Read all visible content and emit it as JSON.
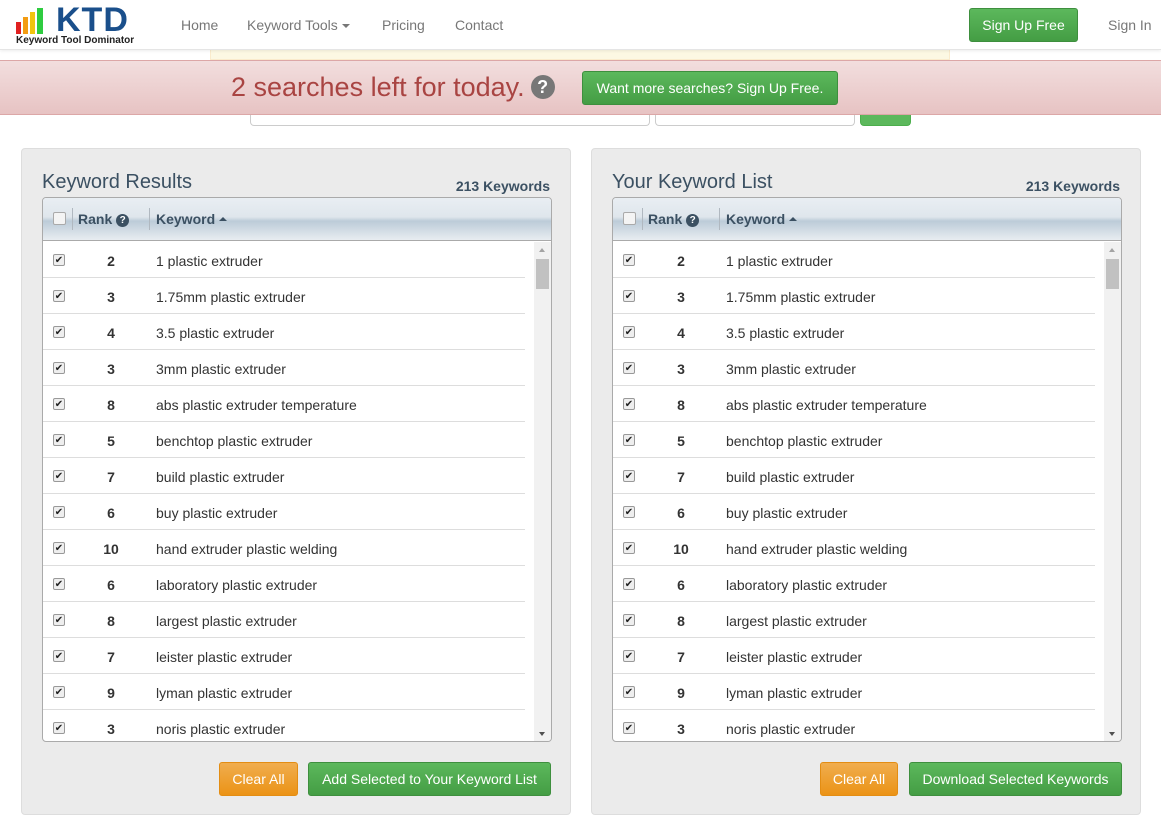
{
  "nav": {
    "logo_text": "KTD",
    "logo_sub": "Keyword Tool Dominator",
    "links": [
      "Home",
      "Keyword Tools",
      "Pricing",
      "Contact"
    ],
    "signup": "Sign Up Free",
    "signin": "Sign In"
  },
  "alert": {
    "message": "2 searches left for today.",
    "help_icon": "?",
    "cta": "Want more searches? Sign Up Free."
  },
  "left": {
    "title": "Keyword Results",
    "count": "213 Keywords",
    "col_rank": "Rank",
    "col_keyword": "Keyword",
    "clear": "Clear All",
    "action": "Add Selected to Your Keyword List"
  },
  "right": {
    "title": "Your Keyword List",
    "count": "213 Keywords",
    "col_rank": "Rank",
    "col_keyword": "Keyword",
    "clear": "Clear All",
    "action": "Download Selected Keywords"
  },
  "rows": [
    {
      "rank": "2",
      "keyword": "1 plastic extruder",
      "checked": true
    },
    {
      "rank": "3",
      "keyword": "1.75mm plastic extruder",
      "checked": true
    },
    {
      "rank": "4",
      "keyword": "3.5 plastic extruder",
      "checked": true
    },
    {
      "rank": "3",
      "keyword": "3mm plastic extruder",
      "checked": true
    },
    {
      "rank": "8",
      "keyword": "abs plastic extruder temperature",
      "checked": true
    },
    {
      "rank": "5",
      "keyword": "benchtop plastic extruder",
      "checked": true
    },
    {
      "rank": "7",
      "keyword": "build plastic extruder",
      "checked": true
    },
    {
      "rank": "6",
      "keyword": "buy plastic extruder",
      "checked": true
    },
    {
      "rank": "10",
      "keyword": "hand extruder plastic welding",
      "checked": true
    },
    {
      "rank": "6",
      "keyword": "laboratory plastic extruder",
      "checked": true
    },
    {
      "rank": "8",
      "keyword": "largest plastic extruder",
      "checked": true
    },
    {
      "rank": "7",
      "keyword": "leister plastic extruder",
      "checked": true
    },
    {
      "rank": "9",
      "keyword": "lyman plastic extruder",
      "checked": true
    },
    {
      "rank": "3",
      "keyword": "noris plastic extruder",
      "checked": true
    }
  ],
  "colors": {
    "green": "#5cb85c",
    "orange": "#f0ad4e",
    "alert_text": "#a94442",
    "heading": "#3b5062",
    "logo_blue": "#1a4f8b"
  }
}
